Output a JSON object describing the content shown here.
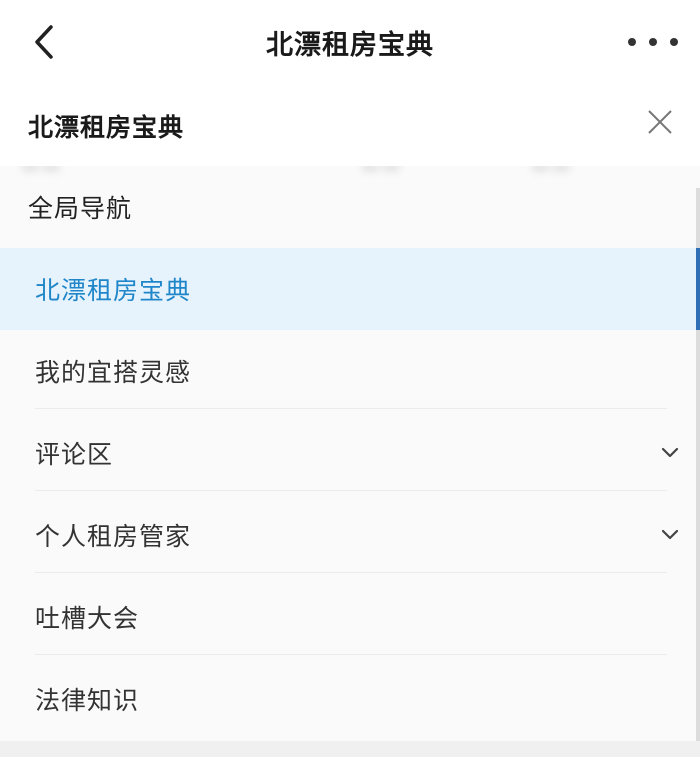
{
  "topbar": {
    "title": "北漂租房宝典",
    "back_icon": "chevron-left-icon",
    "more_icon": "more-horizontal-icon"
  },
  "panel": {
    "title": "北漂租房宝典",
    "close_icon": "close-icon"
  },
  "menu": {
    "global_nav": "全局导航",
    "items": [
      {
        "label": "北漂租房宝典",
        "active": true,
        "expandable": false
      },
      {
        "label": "我的宜搭灵感",
        "active": false,
        "expandable": false
      },
      {
        "label": "评论区",
        "active": false,
        "expandable": true
      },
      {
        "label": "个人租房管家",
        "active": false,
        "expandable": true
      },
      {
        "label": "吐槽大会",
        "active": false,
        "expandable": false
      },
      {
        "label": "法律知识",
        "active": false,
        "expandable": false
      }
    ]
  },
  "colors": {
    "active_text": "#1f86c9",
    "active_bg": "#e6f2fc",
    "active_indicator": "#2e6fb5"
  }
}
